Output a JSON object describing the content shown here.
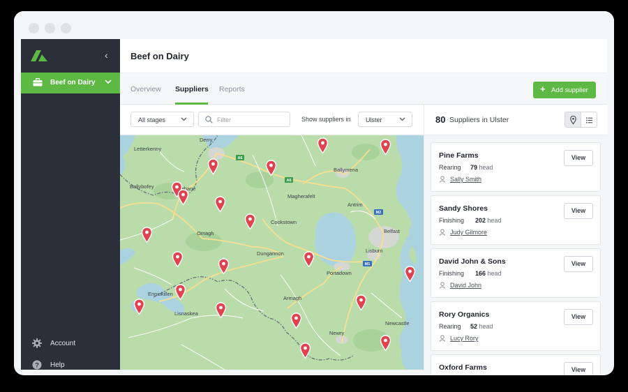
{
  "app": {
    "title": "Beef on Dairy"
  },
  "sidebar": {
    "active_item": "Beef on Dairy",
    "footer": [
      {
        "label": "Account",
        "icon": "gear-icon"
      },
      {
        "label": "Help",
        "icon": "help-icon"
      }
    ]
  },
  "tabs": [
    {
      "label": "Overview",
      "active": false
    },
    {
      "label": "Suppliers",
      "active": true
    },
    {
      "label": "Reports",
      "active": false
    }
  ],
  "actions": {
    "add_supplier": "Add supplier"
  },
  "filters": {
    "stage_value": "All stages",
    "filter_placeholder": "Filter",
    "region_label": "Show suppliers in",
    "region_value": "Ulster"
  },
  "map": {
    "places": [
      "Derry",
      "Letterkenny",
      "Ballybofey",
      "Strabane",
      "Ballymena",
      "Magherafelt",
      "Antrim",
      "Omagh",
      "Cookstown",
      "Belfast",
      "Dungannon",
      "Lisburn",
      "Portadown",
      "Enniskillen",
      "Armagh",
      "Lisnaskea",
      "Newry",
      "Newcastle"
    ],
    "road_labels": [
      "A6",
      "A6",
      "M2",
      "M1"
    ]
  },
  "suppliers": {
    "count": "80",
    "count_label": "Suppliers in Ulster",
    "head_unit": "head",
    "view_label": "View",
    "items": [
      {
        "name": "Pine Farms",
        "stage": "Rearing",
        "heads": "79",
        "contact": "Sally Smith"
      },
      {
        "name": "Sandy Shores",
        "stage": "Finishing",
        "heads": "202",
        "contact": "Judy Gilmore"
      },
      {
        "name": "David John & Sons",
        "stage": "Finishing",
        "heads": "166",
        "contact": "David John"
      },
      {
        "name": "Rory Organics",
        "stage": "Rearing",
        "heads": "52",
        "contact": "Lucy Rory"
      },
      {
        "name": "Oxford Farms",
        "stage": "",
        "heads": "",
        "contact": ""
      }
    ]
  },
  "colors": {
    "brand_green": "#5eb944",
    "sidebar": "#2b2f3a",
    "pin_red": "#e0424f"
  }
}
